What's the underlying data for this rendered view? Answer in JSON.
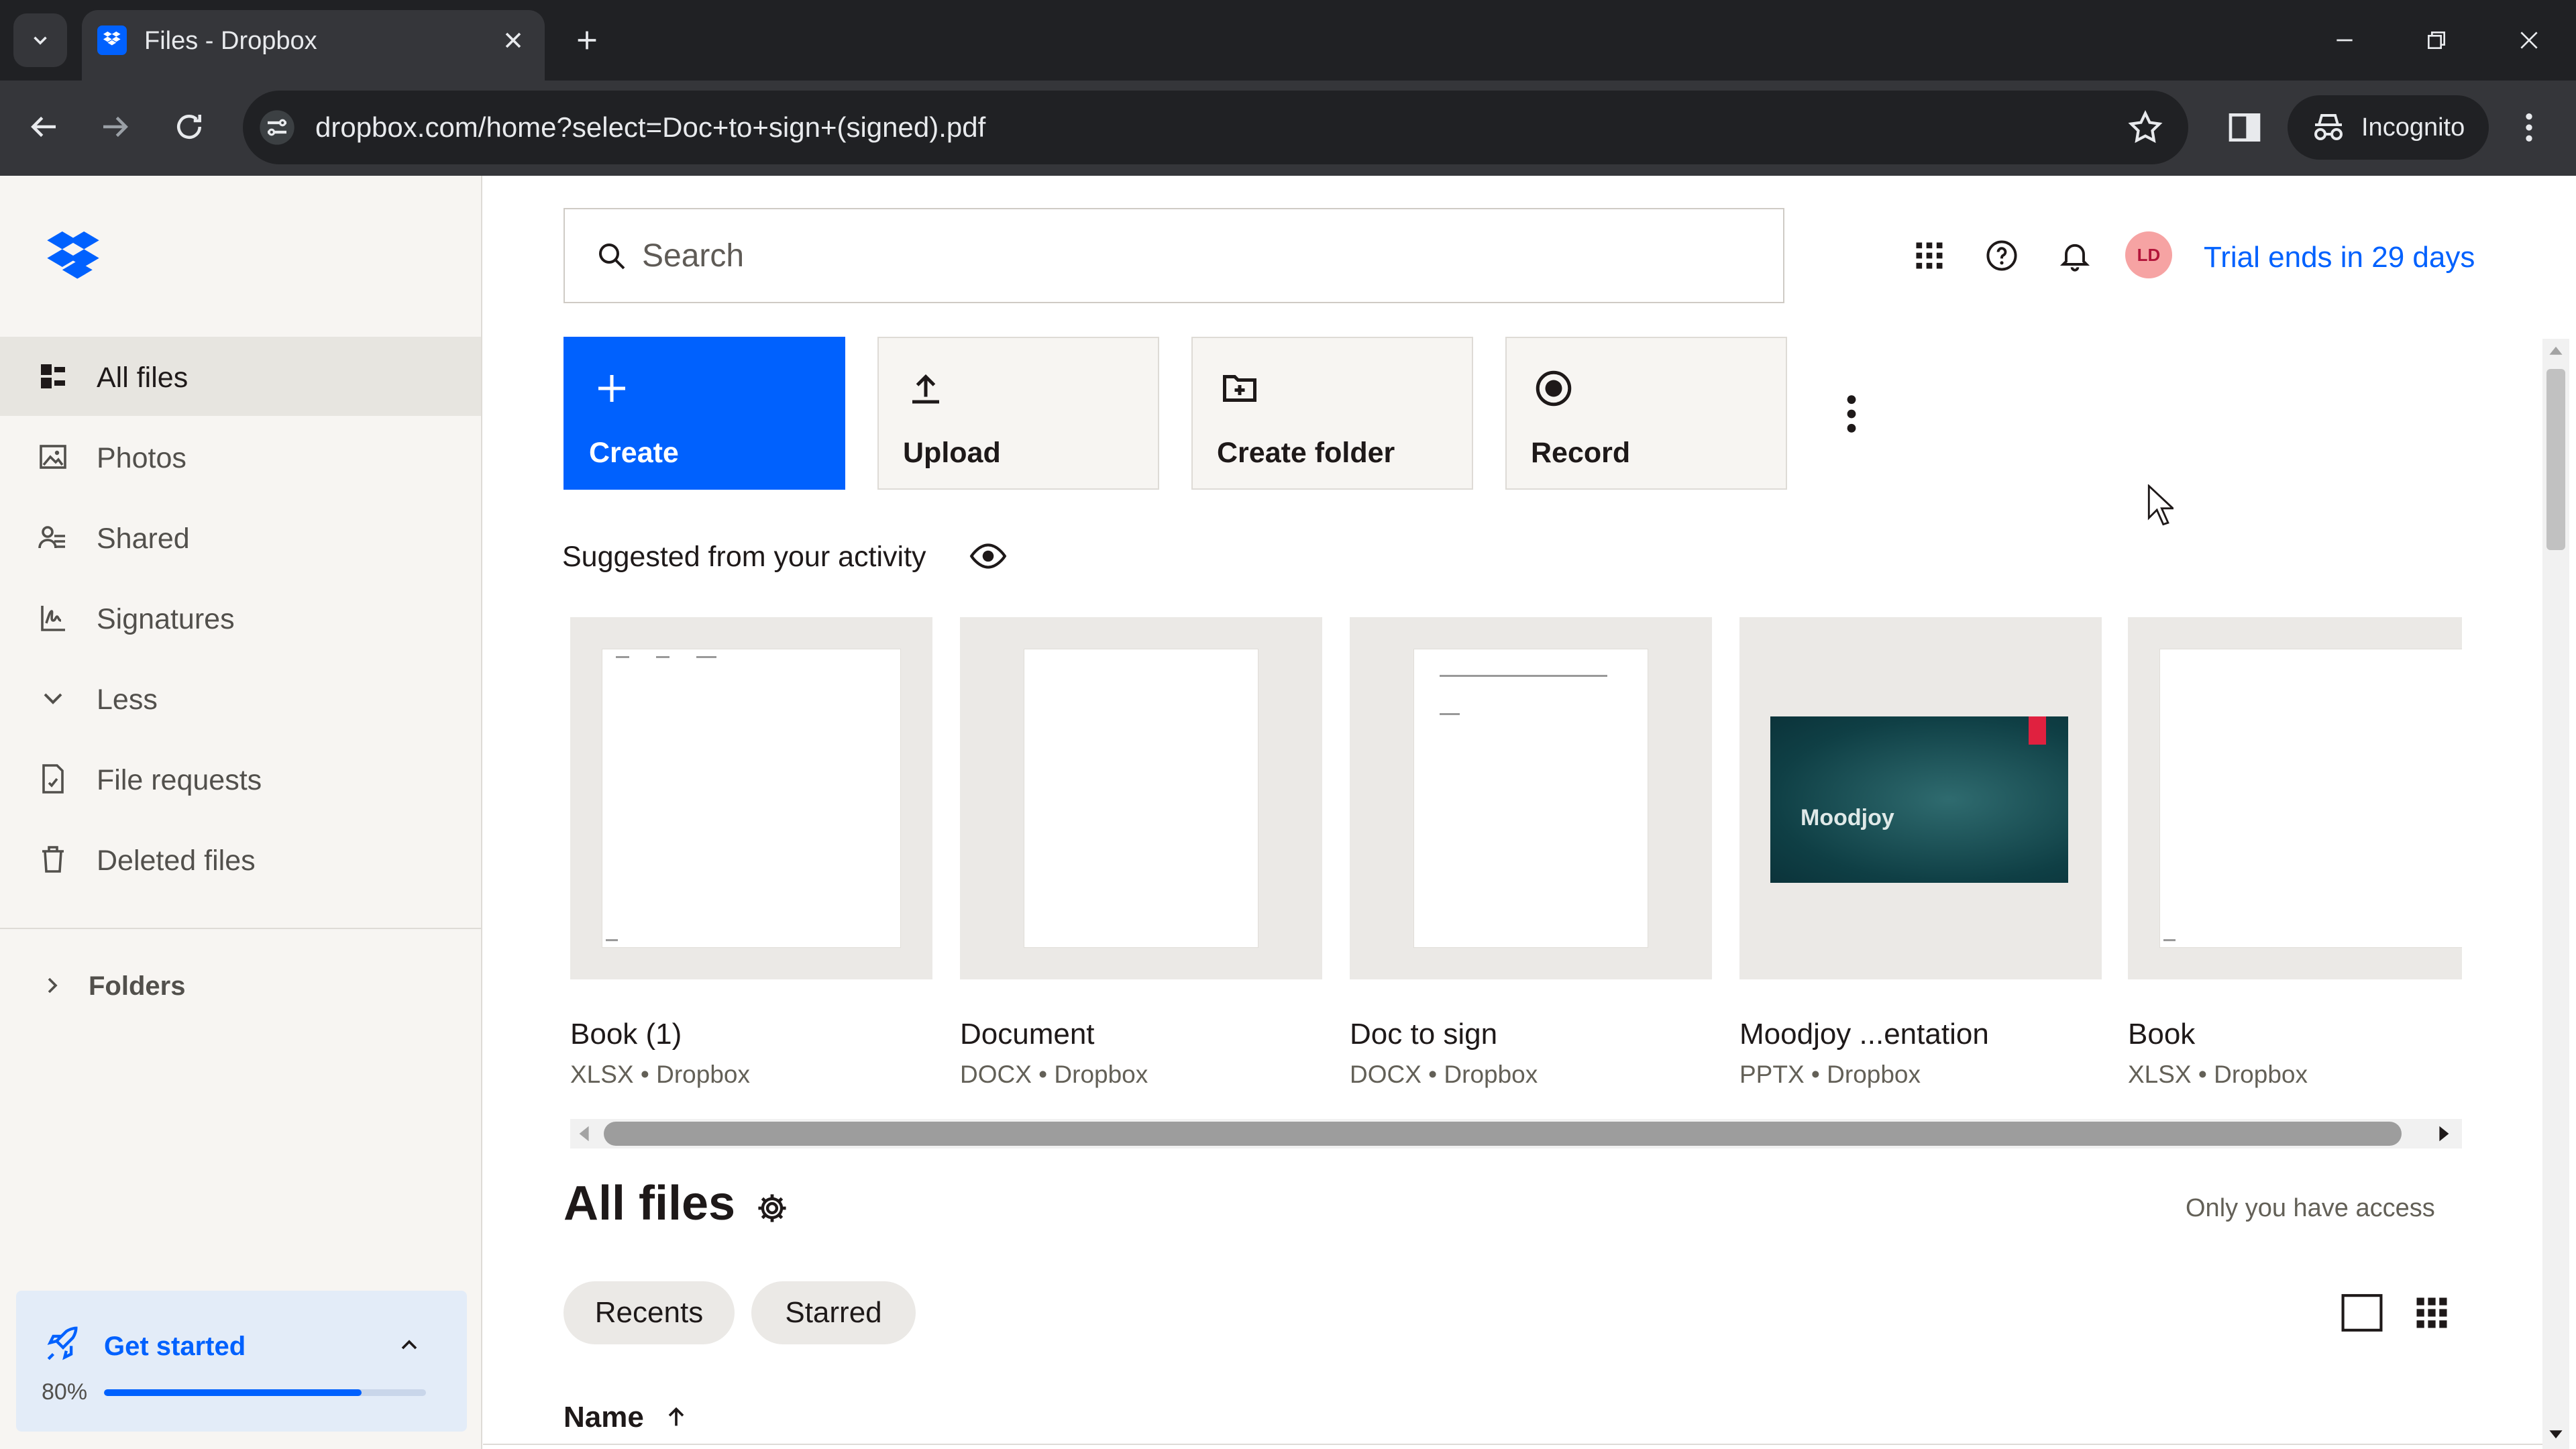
{
  "browser": {
    "tab_title": "Files - Dropbox",
    "url": "dropbox.com/home?select=Doc+to+sign+(signed).pdf",
    "profile_label": "Incognito"
  },
  "sidebar": {
    "items": [
      {
        "label": "All files",
        "icon": "all-files-icon",
        "active": true
      },
      {
        "label": "Photos",
        "icon": "photos-icon"
      },
      {
        "label": "Shared",
        "icon": "shared-icon"
      },
      {
        "label": "Signatures",
        "icon": "signature-icon"
      },
      {
        "label": "Less",
        "icon": "chevron-down-icon"
      },
      {
        "label": "File requests",
        "icon": "file-request-icon"
      },
      {
        "label": "Deleted files",
        "icon": "trash-icon"
      }
    ],
    "folders_label": "Folders",
    "get_started": {
      "label": "Get started",
      "progress_text": "80%",
      "progress": 0.8
    }
  },
  "header": {
    "search_placeholder": "Search",
    "avatar_initials": "LD",
    "trial_text": "Trial ends in 29 days"
  },
  "actions": [
    {
      "label": "Create",
      "icon": "plus-icon"
    },
    {
      "label": "Upload",
      "icon": "upload-icon"
    },
    {
      "label": "Create folder",
      "icon": "create-folder-icon"
    },
    {
      "label": "Record",
      "icon": "record-icon"
    }
  ],
  "suggested": {
    "label": "Suggested from your activity",
    "files": [
      {
        "name": "Book (1)",
        "meta": "XLSX • Dropbox"
      },
      {
        "name": "Document",
        "meta": "DOCX • Dropbox"
      },
      {
        "name": "Doc to sign",
        "meta": "DOCX • Dropbox"
      },
      {
        "name": "Moodjoy ...entation",
        "meta": "PPTX • Dropbox",
        "thumb_text": "Moodjoy"
      },
      {
        "name": "Book",
        "meta": "XLSX • Dropbox"
      }
    ]
  },
  "all_files": {
    "title": "All files",
    "access_text": "Only you have access",
    "filters": [
      "Recents",
      "Starred"
    ],
    "column_name": "Name"
  },
  "colors": {
    "accent": "#0061fe",
    "sidebar_bg": "#f7f5f2",
    "chrome_bg": "#202124"
  }
}
